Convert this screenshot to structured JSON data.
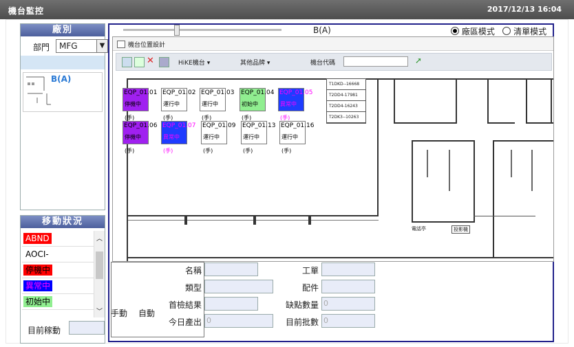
{
  "window": {
    "title": "機台監控",
    "datetime": "2017/12/13 16:04"
  },
  "factory": {
    "header": "廠別",
    "dept_label": "部門",
    "dept_value": "MFG",
    "thumbnail_label": "B(A)"
  },
  "movement": {
    "header": "移動狀況",
    "statuses": [
      {
        "label": "ABND",
        "bg": "#ff0000",
        "fg": "#ffffff"
      },
      {
        "label": "AOCI-",
        "bg": "#ffffff",
        "fg": "#000000"
      },
      {
        "label": "停機中",
        "bg": "#ff0000",
        "fg": "#000000"
      },
      {
        "label": "異常中",
        "bg": "#0000ff",
        "fg": "#ff00ff"
      },
      {
        "label": "初始中",
        "bg": "#90ee90",
        "fg": "#000000"
      }
    ],
    "current_label": "目前稼動"
  },
  "main": {
    "view_title": "B(A)",
    "mode_area": "廠區模式",
    "mode_list": "清單模式",
    "selected_mode": "area"
  },
  "editor": {
    "title": "機台位置設計",
    "toolbar": {
      "hike": "HiKE機台 ▾",
      "other": "其他品牌 ▾",
      "code_label": "機台代碼"
    }
  },
  "floor": {
    "machines": [
      {
        "name": "EQP_01.01",
        "status": "停機中",
        "mode": "(手)",
        "bg": "#a020f0",
        "fg": "#000000",
        "name_color": "#000000"
      },
      {
        "name": "EQP_01.02",
        "status": "運行中",
        "mode": "(手)",
        "bg": "#ffffff",
        "fg": "#000000",
        "name_color": "#000000"
      },
      {
        "name": "EQP_01.03",
        "status": "運行中",
        "mode": "(手)",
        "bg": "#ffffff",
        "fg": "#000000",
        "name_color": "#000000"
      },
      {
        "name": "EQP_01.04",
        "status": "初始中",
        "mode": "(手)",
        "bg": "#90ee90",
        "fg": "#000000",
        "name_color": "#000000"
      },
      {
        "name": "EQP_01.05",
        "status": "異常中",
        "mode": "(手)",
        "bg": "#1e3cff",
        "fg": "#ff00ff",
        "name_color": "#ff00ff"
      },
      {
        "name": "EQP_01.06",
        "status": "停機中",
        "mode": "(手)",
        "bg": "#a020f0",
        "fg": "#000000",
        "name_color": "#000000"
      },
      {
        "name": "EQP_01.07",
        "status": "異常中",
        "mode": "(手)",
        "bg": "#1e3cff",
        "fg": "#ff00ff",
        "name_color": "#ff00ff"
      },
      {
        "name": "EQP_01.09",
        "status": "運行中",
        "mode": "(手)",
        "bg": "#ffffff",
        "fg": "#000000",
        "name_color": "#000000"
      },
      {
        "name": "EQP_01.13",
        "status": "運行中",
        "mode": "(手)",
        "bg": "#ffffff",
        "fg": "#000000",
        "name_color": "#000000"
      },
      {
        "name": "EQP_01.16",
        "status": "運行中",
        "mode": "(手)",
        "bg": "#ffffff",
        "fg": "#000000",
        "name_color": "#000000"
      }
    ],
    "codes": [
      "T1DKD--16668",
      "T2DD4-17981",
      "T2DD4-16243",
      "T2DK3--10263"
    ],
    "room_labels": [
      "電話亭",
      "投影機"
    ]
  },
  "details": {
    "manual": "手動",
    "auto": "自動",
    "name_label": "名稱",
    "type_label": "類型",
    "first_check_label": "首檢結果",
    "today_output_label": "今日產出",
    "today_output_value": "0",
    "work_order_label": "工單",
    "parts_label": "配件",
    "defect_label": "缺點數量",
    "defect_value": "0",
    "batch_label": "目前批數",
    "batch_value": "0"
  }
}
